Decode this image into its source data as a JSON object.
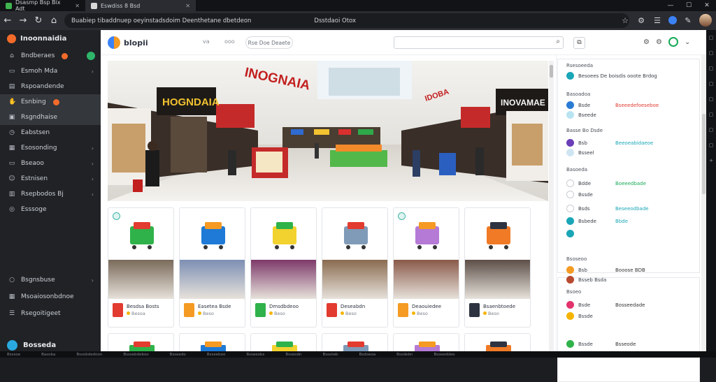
{
  "tabs": [
    {
      "label": "Dsasmp Bsp Bix Adt",
      "active": false
    },
    {
      "label": "Eswdiss 8 Bsd",
      "active": true
    }
  ],
  "browser": {
    "url": "Buabiep tibaddnuep oeyinstadsdoim Deenthetane dbetdeon",
    "url_pill": "Dsstdaoi Otox",
    "accent": "#3b82f6"
  },
  "sidebar": {
    "title": "Inoonnaidia",
    "items": [
      {
        "label": "Bndberaes",
        "icon": "home-icon",
        "badge": true,
        "chevron": false
      },
      {
        "label": "Esmoh Mda",
        "icon": "monitor-icon",
        "badge": false,
        "chevron": true
      },
      {
        "label": "Rspoandende",
        "icon": "book-icon",
        "badge": false,
        "chevron": false
      },
      {
        "label": "Esnbing",
        "icon": "handshake-icon",
        "badge": true,
        "chevron": false
      },
      {
        "label": "Rsgndhaise",
        "icon": "card-icon",
        "badge": false,
        "chevron": false
      },
      {
        "label": "Eabstsen",
        "icon": "clock-icon",
        "badge": false,
        "chevron": false
      },
      {
        "label": "Esosonding",
        "icon": "table-icon",
        "badge": false,
        "chevron": true
      },
      {
        "label": "Bseaoo",
        "icon": "inbox-icon",
        "badge": false,
        "chevron": true
      },
      {
        "label": "Estnisen",
        "icon": "users-icon",
        "badge": false,
        "chevron": true
      },
      {
        "label": "Rsepbodos Bj",
        "icon": "chart-icon",
        "badge": false,
        "chevron": true
      },
      {
        "label": "Esssoge",
        "icon": "target-icon",
        "badge": false,
        "chevron": false
      }
    ],
    "bottom_items": [
      {
        "label": "Bsgnsbuse",
        "icon": "circle-icon"
      },
      {
        "label": "Msoaiosonbdnoe",
        "icon": "grid-icon"
      },
      {
        "label": "Rsegoitigeet",
        "icon": "list-icon"
      }
    ],
    "footer": "Bosseda"
  },
  "page": {
    "brand": "blopii",
    "nav_a": "va",
    "nav_b": "ooo",
    "pill": "Rse Doe Deaete",
    "search_placeholder": ""
  },
  "hero": {
    "sign_main": "INOGNAIA",
    "sign_left": "HOGNDAIA",
    "sign_right": "INOVAMAE",
    "sign_top_right": "IDOBA"
  },
  "products": [
    {
      "name": "Besdsa Bosts",
      "sub": "Besoa",
      "color": "#2fb24a",
      "tint": "#e23b2f"
    },
    {
      "name": "Easetea Bsde",
      "sub": "Beso",
      "color": "#1e7ad6",
      "tint": "#f59a23"
    },
    {
      "name": "Dmsdbdeoo",
      "sub": "Beso",
      "color": "#f2d22e",
      "tint": "#2fb24a"
    },
    {
      "name": "Deseabdn",
      "sub": "Beso",
      "color": "#7f9bb8",
      "tint": "#e23b2f"
    },
    {
      "name": "Deaouiedee",
      "sub": "Beso",
      "color": "#b47ad6",
      "tint": "#f59a23"
    },
    {
      "name": "Bsaenbtoede",
      "sub": "Beso",
      "color": "#f07a26",
      "tint": "#2d3340"
    }
  ],
  "rpanel": {
    "s1_title": "Rsesoeeda",
    "s1_row": "Besoees De boisdis ooote Brdog",
    "s2_title": "Basoadoa",
    "s2_rows": [
      {
        "label": "Bsde",
        "value": "Bseeedefoeseboe",
        "value_color": "#e23b2f"
      },
      {
        "label": "Bseede",
        "value": "",
        "value_color": "#555"
      }
    ],
    "s3_title": "Basse Bo Dsde",
    "s3_rows": [
      {
        "label": "Bsb",
        "value": "Beeoeabidaeoe",
        "value_color": "#1aa6b7"
      },
      {
        "label": "Bsseel",
        "value": "",
        "value_color": "#555"
      }
    ],
    "s4_title": "Basoeda",
    "s4_rows": [
      {
        "label": "Bdde",
        "value": "Boeeedbade",
        "value_color": "#18a957"
      },
      {
        "label": "Bssde",
        "value": "",
        "value_color": "#555"
      },
      {
        "label": "Bsds",
        "value": "Beseeodbade",
        "value_color": "#1aa6b7"
      },
      {
        "label": "Bsbede",
        "value": "Bbde",
        "value_color": "#1aa6b7"
      }
    ],
    "s5_title": "Bsoseoo",
    "s5_rows": [
      {
        "label": "Bsb",
        "value": "Booose BDB",
        "value_color": "#333"
      },
      {
        "label": "Bsseb Bsda",
        "value": "",
        "value_color": "#555"
      }
    ],
    "s6_title": "Bsoeo",
    "s6_rows": [
      {
        "label": "Bsde",
        "value": "Bosseedade",
        "value_color": "#333"
      },
      {
        "label": "Bssde",
        "value": "",
        "value_color": "#555"
      }
    ],
    "s7_row": {
      "label": "Bssde",
      "value": "Bsseode"
    }
  },
  "taskbar": [
    "Bsssoe",
    "Basoba",
    "Bssobdedoon",
    "Bsssebdeboo",
    "Bsseedo",
    "Bsseeboo",
    "Bsseeobs",
    "Bsseodn",
    "Bssoteb",
    "Bsdoeoa",
    "Bssdebn",
    "Bsseeddeo"
  ]
}
